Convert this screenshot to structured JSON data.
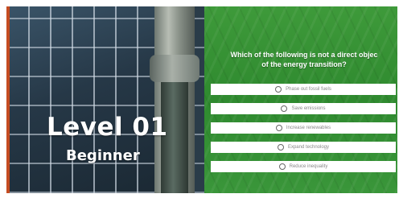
{
  "level": {
    "title": "Level 01",
    "subtitle": "Beginner"
  },
  "quiz": {
    "question_line1": "Which of the following is not a direct objec",
    "question_line2": "of the energy transition?",
    "options": [
      {
        "label": "Phase out fossil fuels"
      },
      {
        "label": "Save emissions"
      },
      {
        "label": "Increase renewables"
      },
      {
        "label": "Expand technology"
      },
      {
        "label": "Reduce inequality"
      }
    ]
  },
  "colors": {
    "quiz_green": "#3a963a",
    "option_background": "#ffffff",
    "title_text": "#ffffff"
  }
}
